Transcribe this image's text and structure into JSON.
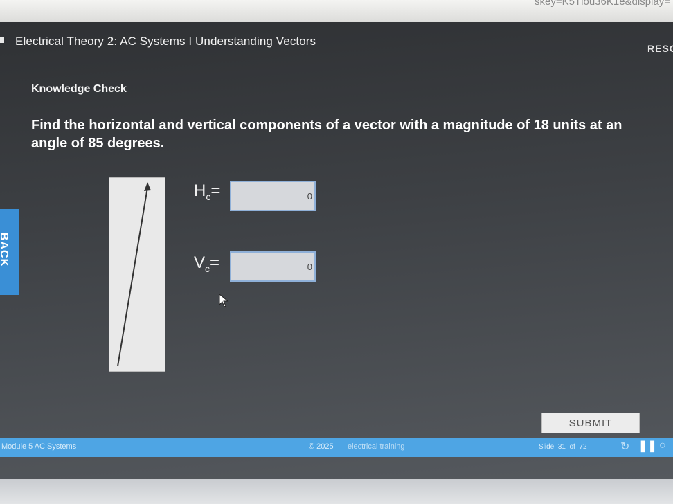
{
  "browser": {
    "url_fragment": "skey=K5Tlou36K1e&display="
  },
  "header": {
    "course_title": "Electrical Theory 2: AC Systems I Understanding Vectors",
    "resources_label": "RESO"
  },
  "content": {
    "section_label": "Knowledge Check",
    "question": "Find the horizontal and vertical components of a vector with a magnitude of 18 units at an angle of 85 degrees.",
    "horizontal": {
      "label_main": "H",
      "label_sub": "c",
      "label_suffix": "=",
      "value": "0"
    },
    "vertical": {
      "label_main": "V",
      "label_sub": "c",
      "label_suffix": "=",
      "value": "0"
    },
    "vector": {
      "magnitude": 18,
      "angle_deg": 85
    }
  },
  "nav": {
    "back_label": "BACK",
    "submit_label": "SUBMIT"
  },
  "footer": {
    "module": "Module 5  AC Systems",
    "copyright": "© 2025",
    "brand": "electrical training",
    "slide_prefix": "Slide",
    "slide_current": "31",
    "slide_of": "of",
    "slide_total": "72",
    "icons": [
      "replay-icon",
      "pause-icon",
      "more-icon"
    ]
  },
  "colors": {
    "accent": "#4ea5e4",
    "back_tab": "#3a8fd6",
    "input_border": "#8fb0d8"
  }
}
